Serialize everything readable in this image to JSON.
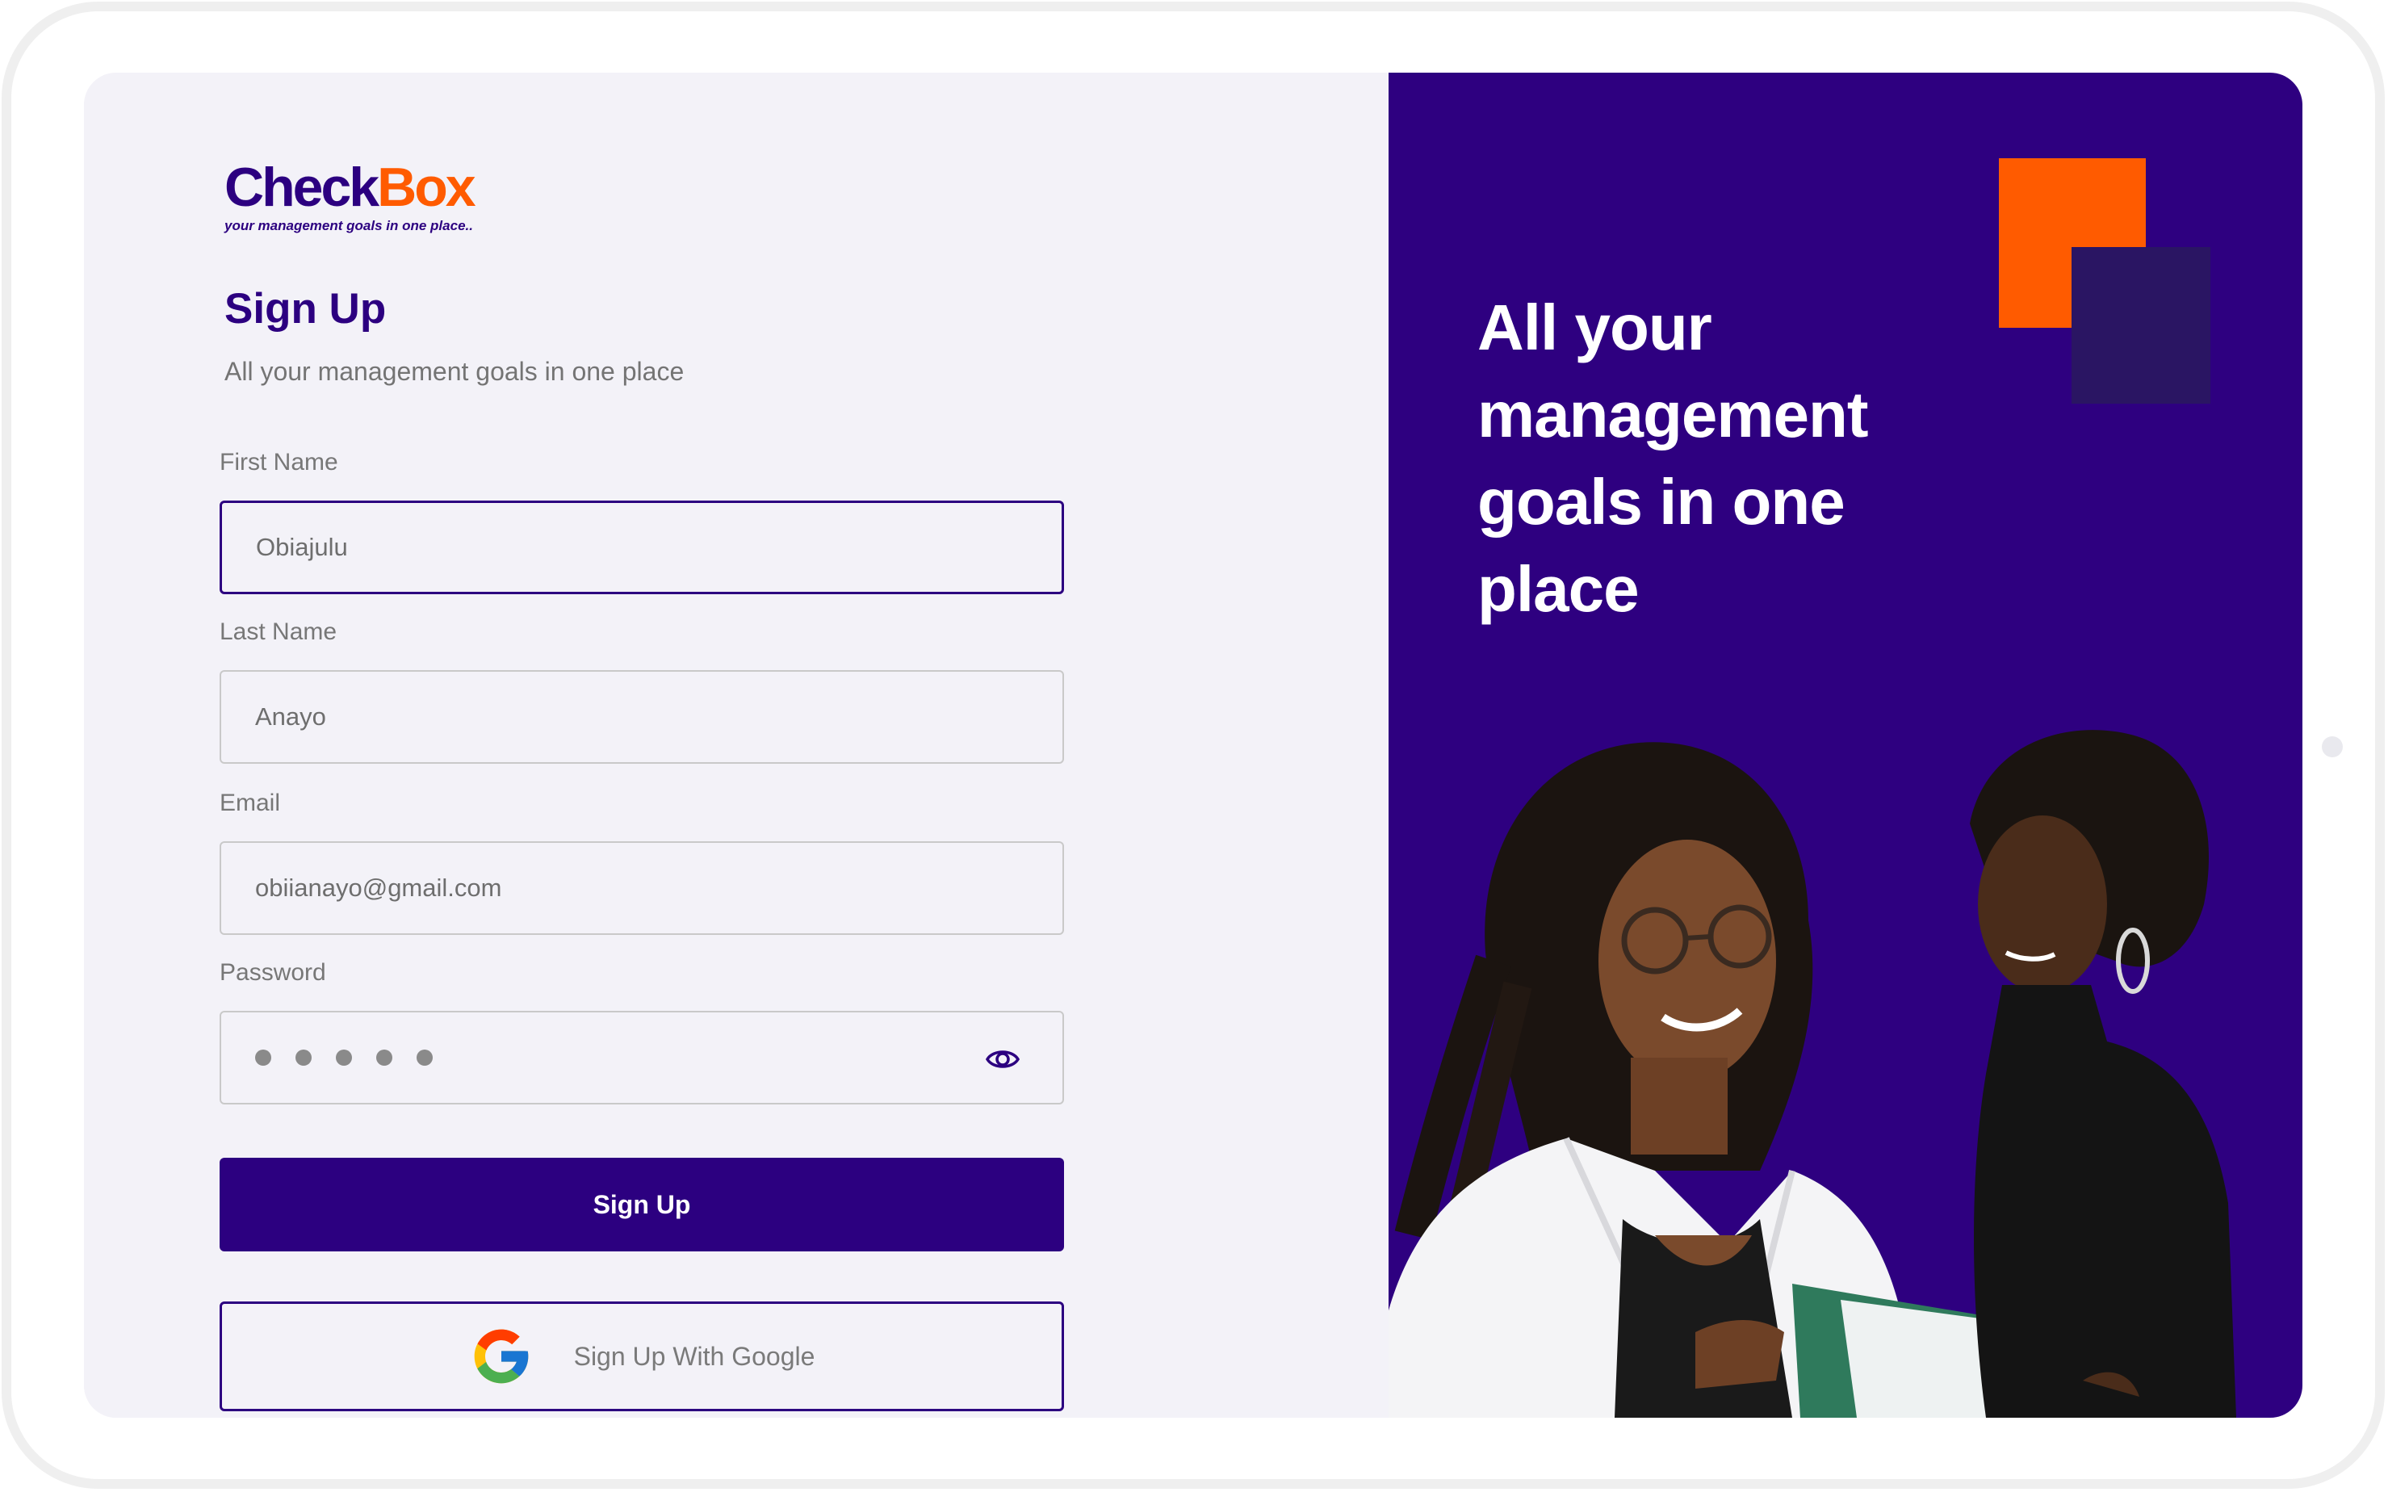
{
  "brand": {
    "name_part1": "Check",
    "name_part2": "Box",
    "tagline": "your management goals in one place..",
    "colors": {
      "primary": "#2c0080",
      "accent": "#ff5b00"
    }
  },
  "form": {
    "title": "Sign Up",
    "subtitle": "All your management goals in one place",
    "fields": {
      "first_name": {
        "label": "First Name",
        "value": "Obiajulu"
      },
      "last_name": {
        "label": "Last Name",
        "value": "Anayo"
      },
      "email": {
        "label": "Email",
        "value": "obiianayo@gmail.com"
      },
      "password": {
        "label": "Password",
        "masked_length": 5,
        "toggle_icon": "eye-icon"
      }
    },
    "submit_label": "Sign Up",
    "google_label": "Sign Up With Google",
    "google_icon": "google-logo-icon"
  },
  "hero": {
    "headline": "All your management goals in one place",
    "image": "two-women-reviewing-document"
  }
}
